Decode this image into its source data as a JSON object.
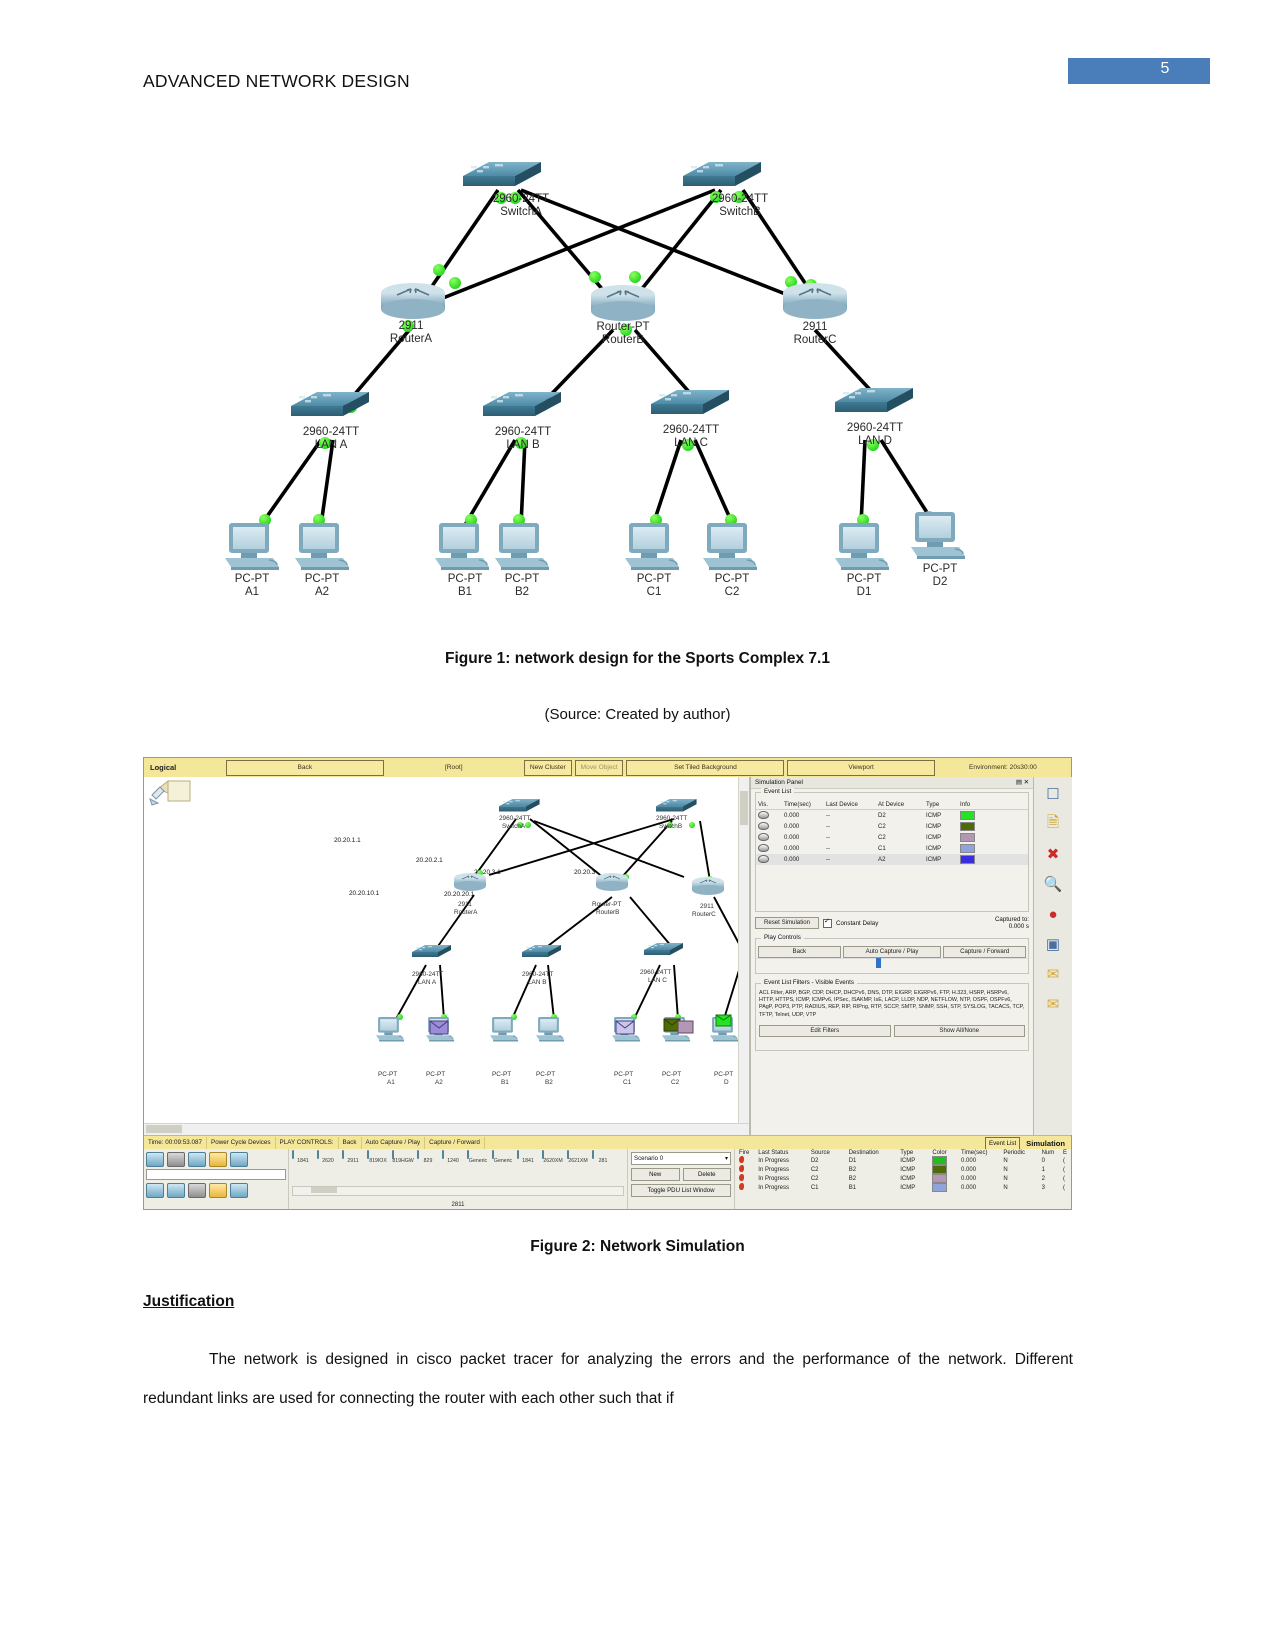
{
  "header": {
    "title": "ADVANCED NETWORK DESIGN",
    "page_number": "5",
    "accent_color": "#4a7ebb"
  },
  "figure1": {
    "caption": "Figure 1: network design for the Sports Complex 7.1",
    "source": "(Source: Created by author)",
    "core_switches": [
      {
        "model": "2960-24TT",
        "name": "SwitchA"
      },
      {
        "model": "2960-24TT",
        "name": "SwitchB"
      }
    ],
    "routers": [
      {
        "model": "2911",
        "name": "RouterA"
      },
      {
        "model": "Router-PT",
        "name": "RouterB"
      },
      {
        "model": "2911",
        "name": "RouterC"
      }
    ],
    "access_switches": [
      {
        "model": "2960-24TT",
        "name": "LAN A"
      },
      {
        "model": "2960-24TT",
        "name": "LAN B"
      },
      {
        "model": "2960-24TT",
        "name": "LAN C"
      },
      {
        "model": "2960-24TT",
        "name": "LAN D"
      }
    ],
    "pcs": [
      {
        "model": "PC-PT",
        "name": "A1"
      },
      {
        "model": "PC-PT",
        "name": "A2"
      },
      {
        "model": "PC-PT",
        "name": "B1"
      },
      {
        "model": "PC-PT",
        "name": "B2"
      },
      {
        "model": "PC-PT",
        "name": "C1"
      },
      {
        "model": "PC-PT",
        "name": "C2"
      },
      {
        "model": "PC-PT",
        "name": "D1"
      },
      {
        "model": "PC-PT",
        "name": "D2"
      }
    ]
  },
  "figure2": {
    "caption": "Figure 2: Network Simulation",
    "toolbar": {
      "mode": "Logical",
      "back": "Back",
      "root": "[Root]",
      "new_cluster": "New Cluster",
      "move_object": "Move Object",
      "set_tiled_background": "Set Tiled Background",
      "viewport": "Viewport",
      "environment": "Environment: 20s30:00"
    },
    "canvas": {
      "ip_labels": [
        "20.20.1.1",
        "20.20.2.1",
        "20.20.3.1",
        "20.20.3",
        "20.20.10.1",
        "20.20.20.1"
      ],
      "devices": [
        {
          "model": "2960-24TT",
          "name": "SwitchA"
        },
        {
          "model": "2960-24TT",
          "name": "SwitchB"
        },
        {
          "model": "2911",
          "name": "RouterA"
        },
        {
          "model": "Router-PT",
          "name": "RouterB"
        },
        {
          "model": "2911",
          "name": "RouterC"
        },
        {
          "model": "2960-24TT",
          "name": "LAN A"
        },
        {
          "model": "2960-24TT",
          "name": "LAN B"
        },
        {
          "model": "2960-24TT",
          "name": "LAN C"
        }
      ],
      "pcs": [
        {
          "model": "PC-PT",
          "name": "A1"
        },
        {
          "model": "PC-PT",
          "name": "A2"
        },
        {
          "model": "PC-PT",
          "name": "B1"
        },
        {
          "model": "PC-PT",
          "name": "B2"
        },
        {
          "model": "PC-PT",
          "name": "C1"
        },
        {
          "model": "PC-PT",
          "name": "C2"
        },
        {
          "model": "PC-PT",
          "name": "D"
        }
      ]
    },
    "simulation_panel": {
      "title": "Simulation Panel",
      "event_list_legend": "Event List",
      "columns": [
        "Vis.",
        "Time(sec)",
        "Last Device",
        "At Device",
        "Type",
        "Info"
      ],
      "rows": [
        {
          "time": "0.000",
          "last_device": "--",
          "at_device": "D2",
          "type": "ICMP",
          "color": "#25e225"
        },
        {
          "time": "0.000",
          "last_device": "--",
          "at_device": "C2",
          "type": "ICMP",
          "color": "#4f6b06"
        },
        {
          "time": "0.000",
          "last_device": "--",
          "at_device": "C2",
          "type": "ICMP",
          "color": "#b497b4"
        },
        {
          "time": "0.000",
          "last_device": "--",
          "at_device": "C1",
          "type": "ICMP",
          "color": "#8fa3dd"
        },
        {
          "time": "0.000",
          "last_device": "--",
          "at_device": "A2",
          "type": "ICMP",
          "color": "#3a2fe0"
        }
      ],
      "reset_simulation": "Reset Simulation",
      "constant_delay": "Constant Delay",
      "captured_to_label": "Captured to:",
      "captured_to_value": "0.000 s",
      "play_controls_legend": "Play Controls",
      "play_back": "Back",
      "auto_capture_play": "Auto Capture / Play",
      "capture_forward": "Capture / Forward",
      "filters_legend": "Event List Filters - Visible Events",
      "filters_text": "ACL Filter, ARP, BGP, CDP, DHCP, DHCPv6, DNS, DTP, EIGRP, EIGRPv6, FTP, H.323, HSRP, HSRPv6, HTTP, HTTPS, ICMP, ICMPv6, IPSec, ISAKMP, IsE, LACP, LLDP, NDP, NETFLOW, NTP, OSPF, OSPFv6, PAgP, POP3, PTP, RADIUS, REP, RIP, RIPng, RTP, SCCP, SMTP, SNMP, SSH, STP, SYSLOG, TACACS, TCP, TFTP, Telnet, UDP, VTP",
      "edit_filters": "Edit Filters",
      "show_all_none": "Show All/None"
    },
    "status_bar": {
      "time": "Time: 00:09:53.087",
      "power_cycle": "Power Cycle Devices",
      "play_controls_label": "PLAY CONTROLS:",
      "back": "Back",
      "auto_capture_play": "Auto Capture / Play",
      "capture_forward": "Capture / Forward",
      "event_list_button": "Event List",
      "simulation_label": "Simulation"
    },
    "bottom_bar": {
      "device_models": [
        "1841",
        "2620",
        "2911",
        "819IOX",
        "819HGW",
        "829",
        "1240",
        "Generic",
        "Generic",
        "1841",
        "2620XM",
        "2621XM",
        "281"
      ],
      "selected_device": "2811",
      "scenario_label": "Scenario 0",
      "new_button": "New",
      "delete_button": "Delete",
      "toggle_pdu": "Toggle PDU List Window",
      "pdu_columns": [
        "Fire",
        "Last Status",
        "Source",
        "Destination",
        "Type",
        "Color",
        "Time(sec)",
        "Periodic",
        "Num",
        "E"
      ],
      "pdu_rows": [
        {
          "status": "In Progress",
          "source": "D2",
          "destination": "D1",
          "type": "ICMP",
          "color": "#1fbf1f",
          "time": "0.000",
          "periodic": "N",
          "num": "0",
          "edit": "("
        },
        {
          "status": "In Progress",
          "source": "C2",
          "destination": "B2",
          "type": "ICMP",
          "color": "#4f6b06",
          "time": "0.000",
          "periodic": "N",
          "num": "1",
          "edit": "("
        },
        {
          "status": "In Progress",
          "source": "C2",
          "destination": "B2",
          "type": "ICMP",
          "color": "#b497b4",
          "time": "0.000",
          "periodic": "N",
          "num": "2",
          "edit": "("
        },
        {
          "status": "In Progress",
          "source": "C1",
          "destination": "B1",
          "type": "ICMP",
          "color": "#8fa3dd",
          "time": "0.000",
          "periodic": "N",
          "num": "3",
          "edit": "("
        }
      ]
    }
  },
  "justification": {
    "heading": "Justification",
    "paragraph": "The network is designed in cisco packet tracer for analyzing the errors and the performance of the network. Different redundant links are used for connecting the router with each other such that if"
  }
}
